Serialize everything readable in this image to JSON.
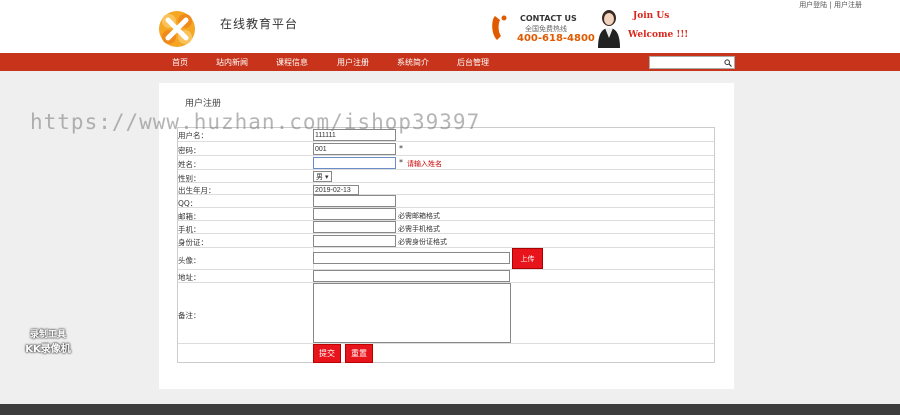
{
  "header": {
    "top_links": [
      "用户登陆",
      "用户注册"
    ],
    "site_title": "在线教育平台",
    "contact_en": "CONTACT US",
    "contact_cn": "全国免费热线",
    "contact_number": "400-618-4800",
    "join_text": "Join Us",
    "welcome_text": "Welcome !!!"
  },
  "nav": {
    "items": [
      "首页",
      "站内新闻",
      "课程信息",
      "用户注册",
      "系统简介",
      "后台管理"
    ],
    "search_placeholder": ""
  },
  "panel": {
    "title": "用户注册"
  },
  "form": {
    "username_label": "用户名：",
    "username_value": "111111",
    "password_label": "密码：",
    "password_value": "001",
    "required_mark": "*",
    "name_label": "姓名：",
    "name_value": "",
    "name_error": "请输入姓名",
    "gender_label": "性别：",
    "gender_value": "男",
    "birth_label": "出生年月：",
    "birth_value": "2019-02-13",
    "qq_label": "QQ：",
    "email_label": "邮箱：",
    "email_hint": "必需邮箱格式",
    "phone_label": "手机：",
    "phone_hint": "必需手机格式",
    "idcard_label": "身份证：",
    "idcard_hint": "必需身份证格式",
    "avatar_label": "头像：",
    "upload_label": "上传",
    "address_label": "地址：",
    "remark_label": "备注：",
    "submit_label": "提交",
    "reset_label": "重置"
  },
  "overlay": {
    "watermark": "https://www.huzhan.com/ishop39397",
    "recorder_line1": "录制工具",
    "recorder_line2": "KK录像机"
  },
  "colors": {
    "nav_bg": "#c7341b",
    "button_red": "#e8141c",
    "accent_orange": "#e05a00"
  }
}
